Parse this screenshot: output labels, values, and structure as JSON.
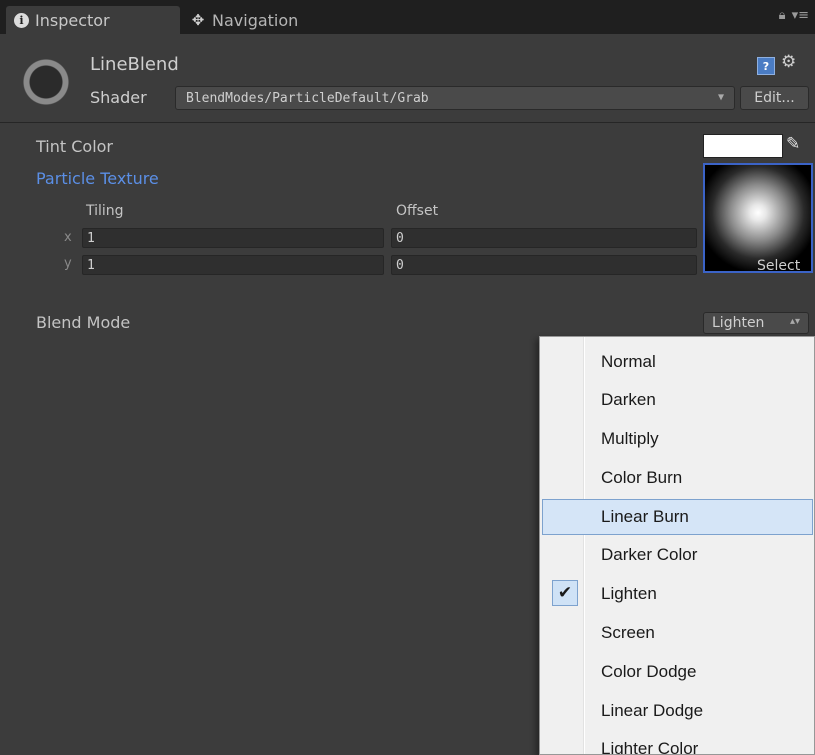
{
  "tabs": [
    {
      "label": "Inspector",
      "icon": "info-icon",
      "active": true
    },
    {
      "label": "Navigation",
      "icon": "navigation-icon",
      "active": false
    }
  ],
  "tabbar_icons": [
    "lock-icon",
    "menu-icon"
  ],
  "material": {
    "name": "LineBlend",
    "shader_label": "Shader",
    "shader_value": "BlendModes/ParticleDefault/Grab",
    "edit_label": "Edit..."
  },
  "properties": {
    "tint_label": "Tint Color",
    "tint_color": "#ffffff",
    "texture_label": "Particle Texture",
    "tiling_label": "Tiling",
    "offset_label": "Offset",
    "x_label": "x",
    "y_label": "y",
    "tiling_x": "1",
    "tiling_y": "1",
    "offset_x": "0",
    "offset_y": "0",
    "select_label": "Select",
    "blend_label": "Blend Mode",
    "blend_value": "Lighten"
  },
  "blend_menu": {
    "items": [
      "Normal",
      "Darken",
      "Multiply",
      "Color Burn",
      "Linear Burn",
      "Darker Color",
      "Lighten",
      "Screen",
      "Color Dodge",
      "Linear Dodge",
      "Lighter Color"
    ],
    "hovered": "Linear Burn",
    "checked": "Lighten"
  },
  "colors": {
    "accent": "#5b8fe6",
    "panel": "#3c3c3c",
    "menu_bg": "#f0f0f0"
  }
}
